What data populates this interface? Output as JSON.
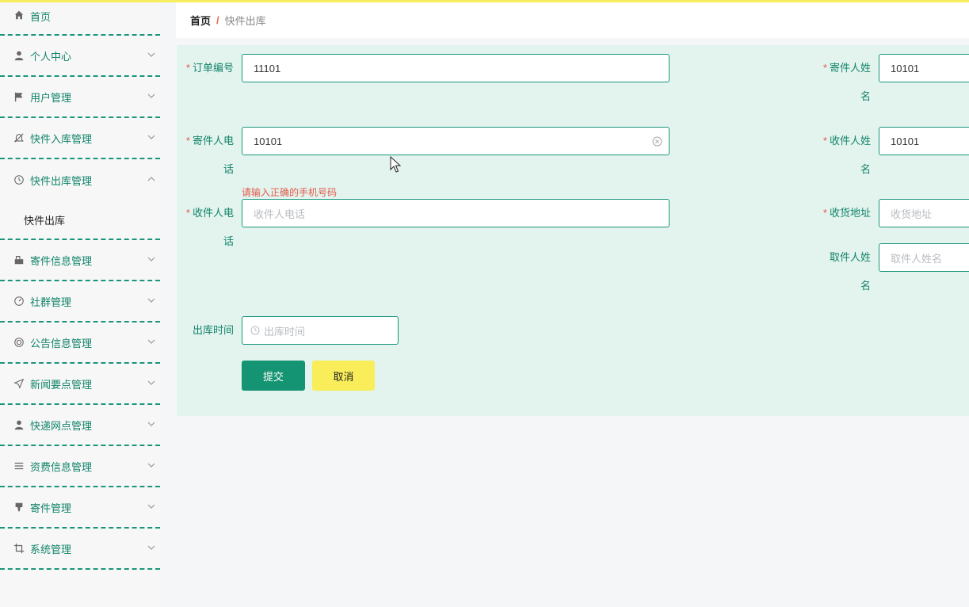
{
  "sidebar": {
    "items": [
      {
        "label": "首页",
        "icon": "home-icon"
      },
      {
        "label": "个人中心",
        "icon": "user-icon"
      },
      {
        "label": "用户管理",
        "icon": "flag-icon"
      },
      {
        "label": "快件入库管理",
        "icon": "bell-off-icon"
      },
      {
        "label": "快件出库管理",
        "icon": "clock-icon"
      },
      {
        "label": "寄件信息管理",
        "icon": "box-icon"
      },
      {
        "label": "社群管理",
        "icon": "gauge-icon"
      },
      {
        "label": "公告信息管理",
        "icon": "target-icon"
      },
      {
        "label": "新闻要点管理",
        "icon": "send-icon"
      },
      {
        "label": "快递网点管理",
        "icon": "user-icon"
      },
      {
        "label": "资费信息管理",
        "icon": "list-icon"
      },
      {
        "label": "寄件管理",
        "icon": "brush-icon"
      },
      {
        "label": "系统管理",
        "icon": "crop-icon"
      }
    ],
    "submenu_label": "快件出库"
  },
  "breadcrumb": {
    "home": "首页",
    "separator": "/",
    "current": "快件出库"
  },
  "form": {
    "required_mark": "*",
    "order_no": {
      "label": "订单编号",
      "value": "11101"
    },
    "sender_name": {
      "label_line1": "寄件人姓",
      "label_line2": "名",
      "value": "10101"
    },
    "sender_phone": {
      "label_line1": "寄件人电",
      "label_line2": "话",
      "value": "10101",
      "error": "请输入正确的手机号码"
    },
    "receiver_name": {
      "label_line1": "收件人姓",
      "label_line2": "名",
      "value": "10101"
    },
    "receiver_phone": {
      "label_line1": "收件人电",
      "label_line2": "话",
      "placeholder": "收件人电话"
    },
    "address": {
      "label": "收货地址",
      "placeholder": "收货地址"
    },
    "picker_name": {
      "label_line1": "取件人姓",
      "label_line2": "名",
      "placeholder": "取件人姓名"
    },
    "out_time": {
      "label": "出库时间",
      "placeholder": "出库时间"
    },
    "submit_label": "提交",
    "cancel_label": "取消"
  },
  "colors": {
    "accent": "#149472",
    "label": "#12846a",
    "error": "#e25b4a",
    "cancel": "#f9ee5a",
    "panel": "#e3f3ee"
  }
}
